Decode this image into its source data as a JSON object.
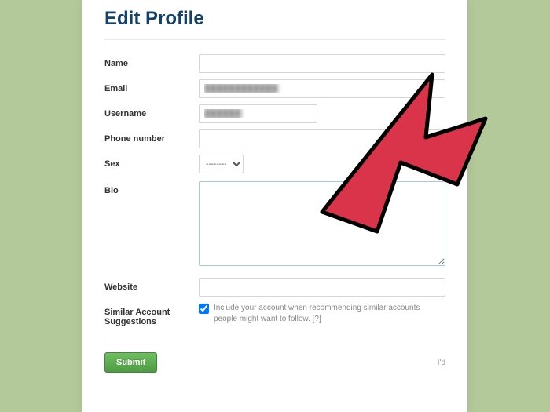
{
  "title": "Edit Profile",
  "labels": {
    "name": "Name",
    "email": "Email",
    "username": "Username",
    "phone": "Phone number",
    "sex": "Sex",
    "bio": "Bio",
    "website": "Website",
    "similar": "Similar Account Suggestions"
  },
  "values": {
    "name": "",
    "email": "████████████",
    "username": "██████",
    "phone": "",
    "sex": "--------",
    "bio": "",
    "website": ""
  },
  "similar_text": "Include your account when recommending similar accounts people might want to follow.",
  "help_link": "[?]",
  "submit_label": "Submit",
  "right_truncated": "I'd"
}
